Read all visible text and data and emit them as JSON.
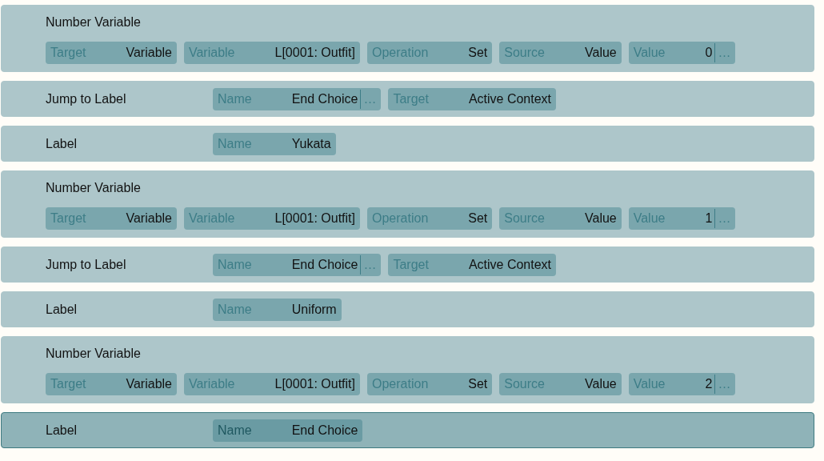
{
  "commands": [
    {
      "kind": "multiline",
      "title": "Number Variable",
      "selected": false,
      "params": [
        {
          "label": "Target",
          "value": "Variable"
        },
        {
          "label": "Variable",
          "value": "L[0001: Outfit]"
        },
        {
          "label": "Operation",
          "value": "Set"
        },
        {
          "label": "Source",
          "value": "Value"
        },
        {
          "label": "Value",
          "value": "0",
          "more": "…"
        }
      ]
    },
    {
      "kind": "inline",
      "title": "Jump to Label",
      "selected": false,
      "params": [
        {
          "label": "Name",
          "value": "End Choice",
          "more": "…"
        },
        {
          "label": "Target",
          "value": "Active Context"
        }
      ]
    },
    {
      "kind": "inline",
      "title": "Label",
      "selected": false,
      "params": [
        {
          "label": "Name",
          "value": "Yukata"
        }
      ]
    },
    {
      "kind": "multiline",
      "title": "Number Variable",
      "selected": false,
      "params": [
        {
          "label": "Target",
          "value": "Variable"
        },
        {
          "label": "Variable",
          "value": "L[0001: Outfit]"
        },
        {
          "label": "Operation",
          "value": "Set"
        },
        {
          "label": "Source",
          "value": "Value"
        },
        {
          "label": "Value",
          "value": "1",
          "more": "…"
        }
      ]
    },
    {
      "kind": "inline",
      "title": "Jump to Label",
      "selected": false,
      "params": [
        {
          "label": "Name",
          "value": "End Choice",
          "more": "…"
        },
        {
          "label": "Target",
          "value": "Active Context"
        }
      ]
    },
    {
      "kind": "inline",
      "title": "Label",
      "selected": false,
      "params": [
        {
          "label": "Name",
          "value": "Uniform"
        }
      ]
    },
    {
      "kind": "multiline",
      "title": "Number Variable",
      "selected": false,
      "params": [
        {
          "label": "Target",
          "value": "Variable"
        },
        {
          "label": "Variable",
          "value": "L[0001: Outfit]"
        },
        {
          "label": "Operation",
          "value": "Set"
        },
        {
          "label": "Source",
          "value": "Value"
        },
        {
          "label": "Value",
          "value": "2",
          "more": "…"
        }
      ]
    },
    {
      "kind": "inline",
      "title": "Label",
      "selected": true,
      "params": [
        {
          "label": "Name",
          "value": "End Choice"
        }
      ]
    }
  ]
}
